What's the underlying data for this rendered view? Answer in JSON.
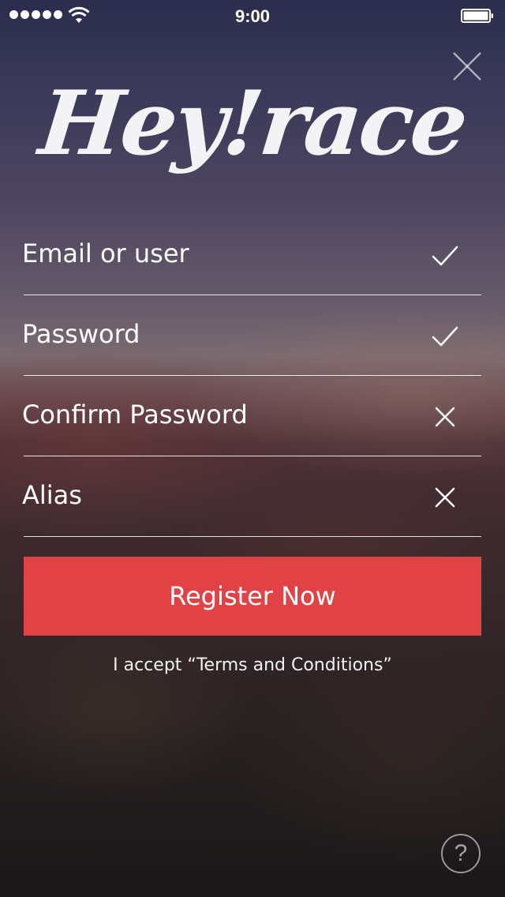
{
  "status_bar": {
    "time": "9:00",
    "signal_icon": "signal-dots-icon",
    "wifi_icon": "wifi-icon",
    "battery_icon": "battery-icon"
  },
  "header": {
    "close_icon": "close-icon",
    "logo_text": "Hey!race"
  },
  "form": {
    "fields": [
      {
        "placeholder": "Email or user",
        "status_icon": "check-icon",
        "status": "valid"
      },
      {
        "placeholder": "Password",
        "status_icon": "check-icon",
        "status": "valid"
      },
      {
        "placeholder": "Confirm Password",
        "status_icon": "x-icon",
        "status": "invalid"
      },
      {
        "placeholder": "Alias",
        "status_icon": "x-icon",
        "status": "invalid"
      }
    ]
  },
  "register_button": {
    "label": "Register Now",
    "color": "#e04246"
  },
  "terms_text": "I accept “Terms and Conditions”",
  "help": {
    "label": "?",
    "icon": "help-icon"
  }
}
